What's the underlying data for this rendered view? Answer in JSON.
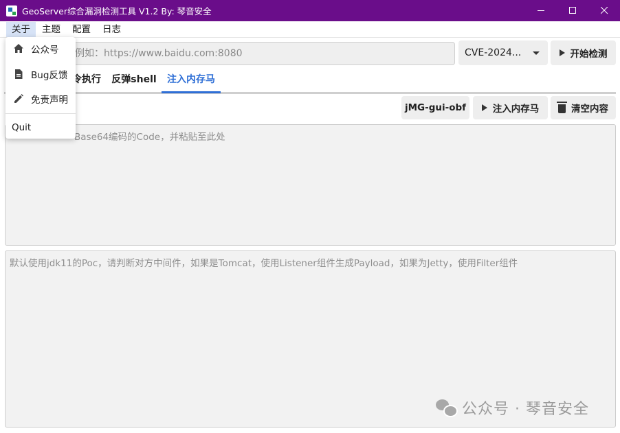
{
  "window": {
    "title": "GeoServer综合漏洞检测工具 V1.2 By: 琴音安全",
    "controls": [
      "minimize-icon",
      "maximize-icon",
      "close-icon"
    ]
  },
  "menubar": {
    "items": [
      "关于",
      "主题",
      "配置",
      "日志"
    ]
  },
  "about_menu": {
    "items": [
      {
        "label": "公众号",
        "icon": "home-icon"
      },
      {
        "label": "Bug反馈",
        "icon": "document-icon"
      },
      {
        "label": "免责声明",
        "icon": "pencil-icon"
      }
    ],
    "quit": "Quit"
  },
  "url_bar": {
    "placeholder_visible": "例如：https://www.baidu.com:8080"
  },
  "cve_select": {
    "value": "CVE-2024..."
  },
  "start_button": {
    "label": "开始检测"
  },
  "tabs": {
    "visible": [
      "令执行",
      "反弹shell",
      "注入内存马"
    ],
    "active": "注入内存马"
  },
  "toolbar": {
    "obf_button": "jMG-gui-obf",
    "inject_button": "注入内存马",
    "clear_button": "清空内容"
  },
  "code_area": {
    "placeholder_visible": "Base64编码的Code，并粘贴至此处"
  },
  "output_area": {
    "placeholder": "默认使用jdk11的Poc，请判断对方中间件，如果是Tomcat，使用Listener组件生成Payload，如果为Jetty，使用Filter组件"
  },
  "watermark": {
    "text": "公众号 · 琴音安全"
  },
  "colors": {
    "titlebar": "#6a0d8a",
    "accent": "#2f6fd6"
  }
}
